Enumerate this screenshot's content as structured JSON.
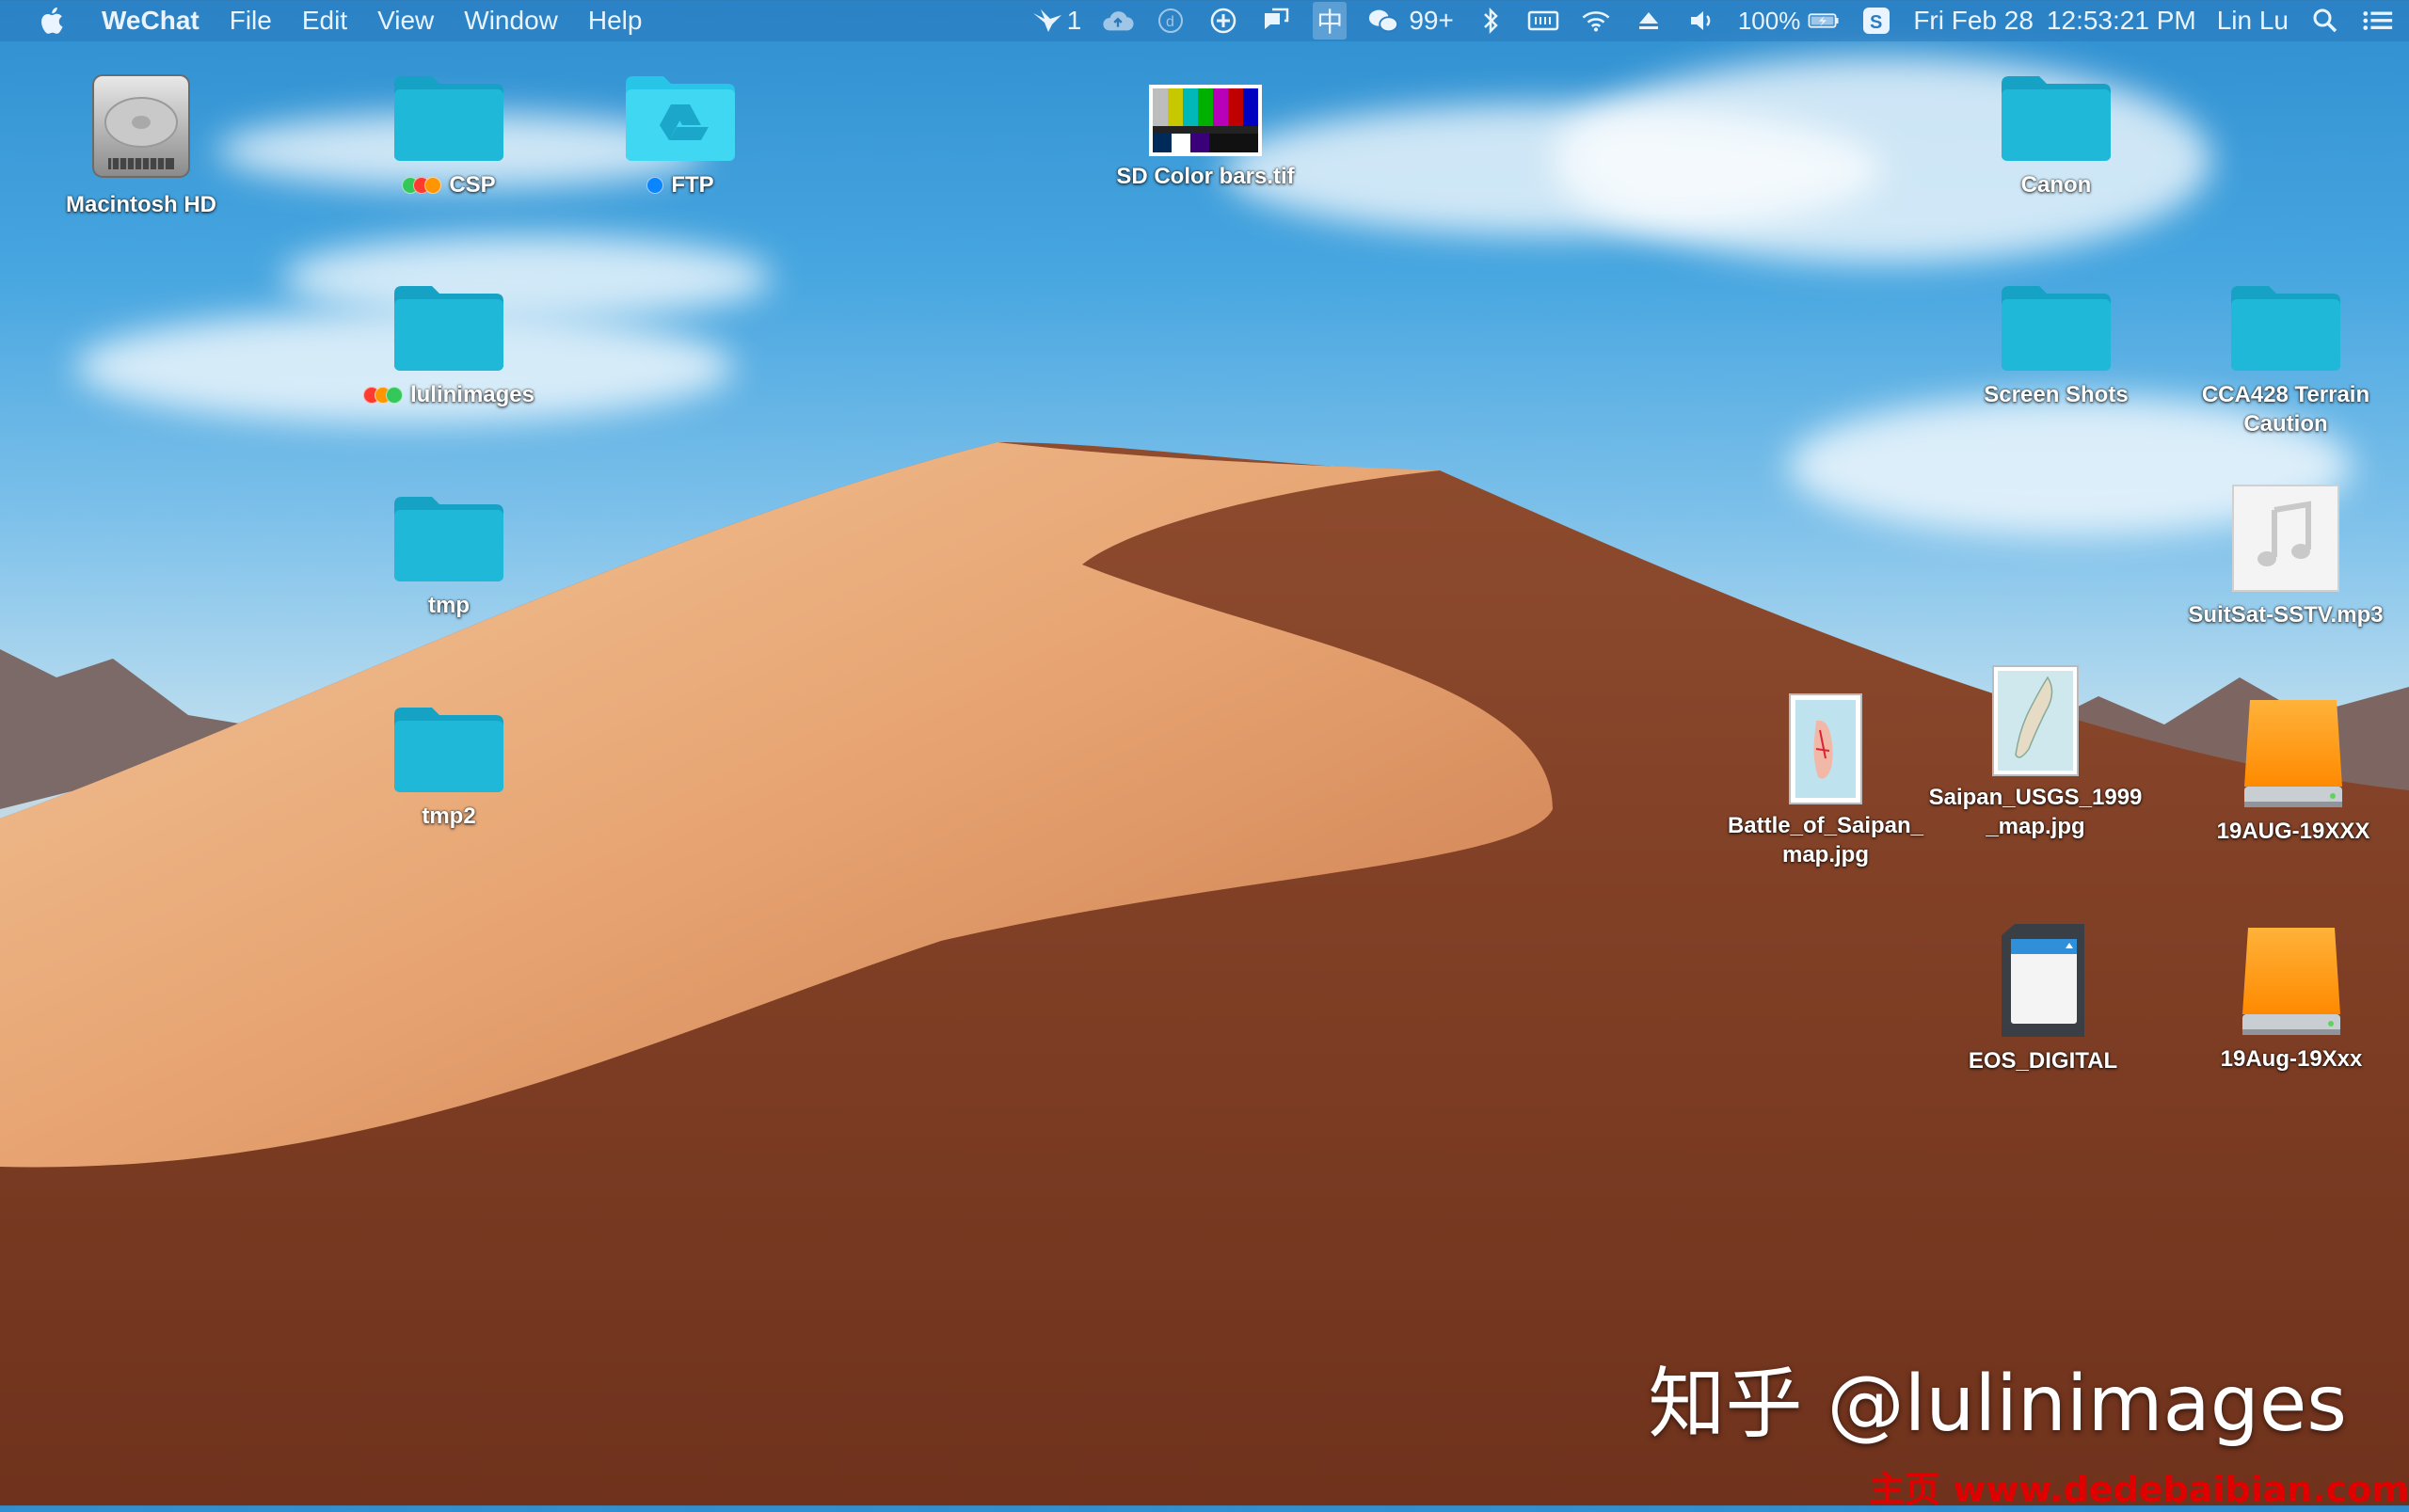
{
  "menubar": {
    "app_name": "WeChat",
    "menus": [
      "File",
      "Edit",
      "View",
      "Window",
      "Help"
    ],
    "status": {
      "notification_count": "1",
      "wechat_badge": "99+",
      "battery": "100%",
      "date": "Fri Feb 28",
      "time": "12:53:21 PM",
      "user": "Lin Lu",
      "input_method": "中"
    }
  },
  "desktop": {
    "items": [
      {
        "label": "Macintosh HD",
        "kind": "hard-drive"
      },
      {
        "label": "CSP",
        "kind": "folder",
        "tags": [
          "#34c759",
          "#ff3b30",
          "#ff9500"
        ]
      },
      {
        "label": "FTP",
        "kind": "folder-drive",
        "tags": [
          "#0a84ff"
        ]
      },
      {
        "label": "SD Color bars.tif",
        "kind": "image"
      },
      {
        "label": "Canon",
        "kind": "folder"
      },
      {
        "label": "lulinimages",
        "kind": "folder",
        "tags": [
          "#ff3b30",
          "#ff9500",
          "#34c759"
        ]
      },
      {
        "label": "Screen Shots",
        "kind": "folder"
      },
      {
        "label": "CCA428 Terrain Caution",
        "kind": "folder"
      },
      {
        "label": "tmp",
        "kind": "folder"
      },
      {
        "label": "SuitSat-SSTV.mp3",
        "kind": "audio"
      },
      {
        "label": "tmp2",
        "kind": "folder"
      },
      {
        "label": "Battle_of_Saipan_map.jpg",
        "kind": "image"
      },
      {
        "label": "Saipan_USGS_1999_map.jpg",
        "kind": "image"
      },
      {
        "label": "19AUG-19XXX",
        "kind": "external-drive"
      },
      {
        "label": "EOS_DIGITAL",
        "kind": "sd-card"
      },
      {
        "label": "19Aug-19Xxx",
        "kind": "external-drive"
      }
    ],
    "label_lines": {
      "battle_1": "Battle_of_Saipan_",
      "battle_2": "map.jpg",
      "saipan_1": "Saipan_USGS_1999",
      "saipan_2": "_map.jpg",
      "cca_1": "CCA428 Terrain",
      "cca_2": "Caution"
    }
  },
  "overlay": {
    "watermark": "知乎 @lulinimages",
    "site": "主页 www.dedebaibian.com"
  },
  "colors": {
    "folder": "#1fb8d8",
    "folder_tab": "#16a2c4",
    "drive_orange": "#ff9d0a",
    "menubar_text": "#eaf4ff"
  }
}
